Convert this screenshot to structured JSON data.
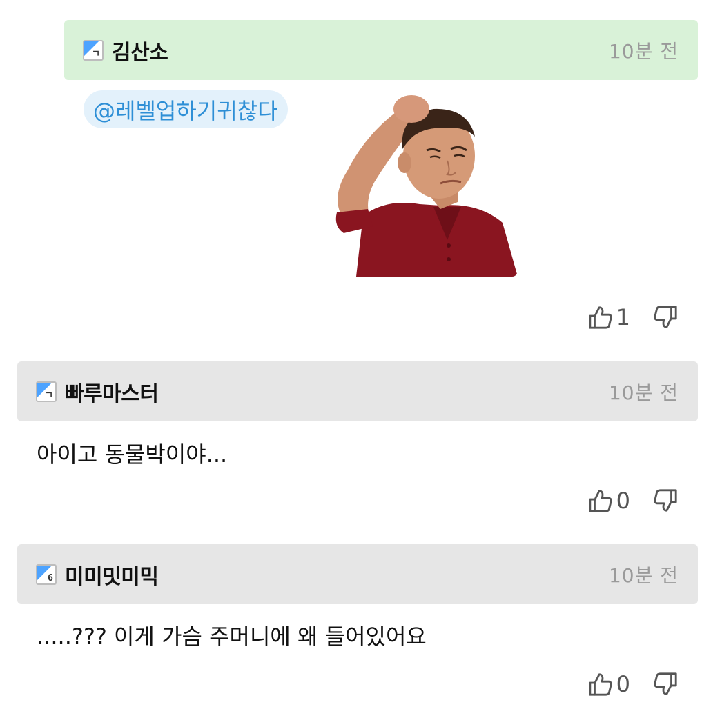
{
  "comments": [
    {
      "author": "김산소",
      "level": "ㄱ",
      "time": "10분 전",
      "mention": "@레벨업하기귀찮다",
      "likes": "1"
    },
    {
      "author": "빠루마스터",
      "level": "ㄱ",
      "time": "10분 전",
      "text": "아이고 동물박이야...",
      "likes": "0"
    },
    {
      "author": "미미밋미믹",
      "level": "6",
      "time": "10분 전",
      "text": ".....??? 이게 가슴 주머니에 왜 들어있어요",
      "likes": "0"
    }
  ],
  "icons": {
    "like": "thumbs-up-icon",
    "dislike": "thumbs-down-icon"
  },
  "colors": {
    "reply_header_bg": "#d9f2d8",
    "comment_header_bg": "#e6e6e6",
    "mention_text": "#2e8fd6",
    "mention_bg": "#e3f1fb",
    "timestamp": "#9a9a9a"
  }
}
